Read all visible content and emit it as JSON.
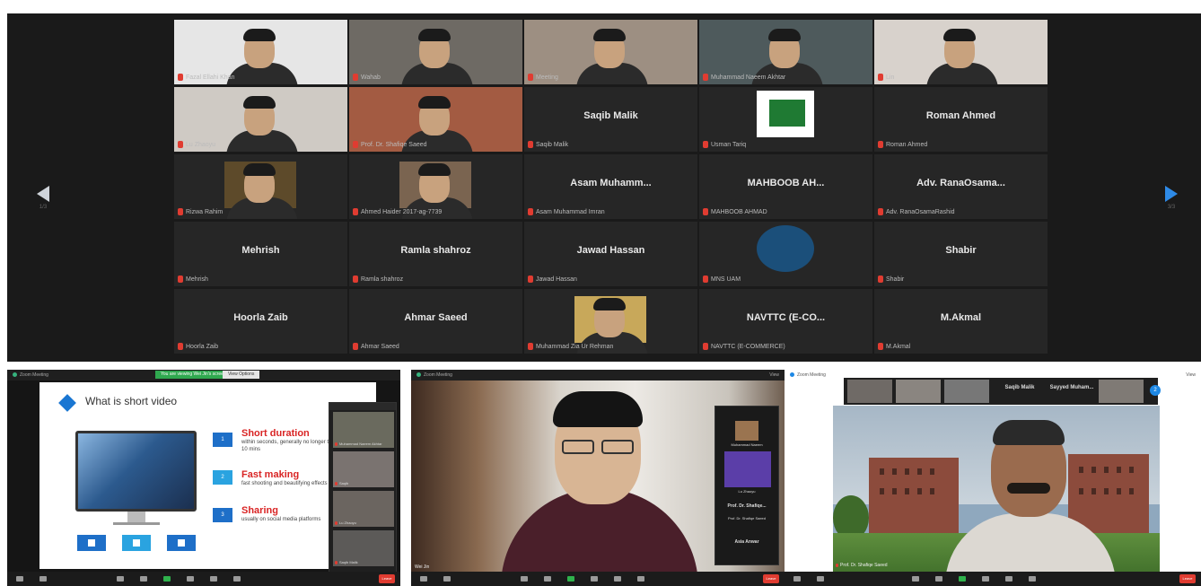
{
  "gallery": {
    "prev_page_label": "1/3",
    "next_page_label": "3/3",
    "tiles": [
      {
        "name": "Fazal Ellahi Khan",
        "center": "",
        "video": true
      },
      {
        "name": "Wahab",
        "center": "",
        "video": true
      },
      {
        "name": "Meeting",
        "center": "",
        "video": true
      },
      {
        "name": "Muhammad Naeem Akhtar",
        "center": "",
        "video": true
      },
      {
        "name": "Lin",
        "center": "",
        "video": true
      },
      {
        "name": "Lu Zhaoyu",
        "center": "",
        "video": true
      },
      {
        "name": "Prof. Dr. Shafiqe Saeed",
        "center": "",
        "video": true
      },
      {
        "name": "Saqib Malik",
        "center": "Saqib Malik",
        "video": false
      },
      {
        "name": "Usman Tariq",
        "center": "",
        "video": false
      },
      {
        "name": "Roman Ahmed",
        "center": "Roman Ahmed",
        "video": false
      },
      {
        "name": "Rizwa Rahim",
        "center": "",
        "video": true
      },
      {
        "name": "Ahmed Haider 2017-ag-7739",
        "center": "",
        "video": true
      },
      {
        "name": "Asam Muhammad Imran",
        "center": "Asam Muhamm...",
        "video": false
      },
      {
        "name": "MAHBOOB AHMAD",
        "center": "MAHBOOB AH...",
        "video": false
      },
      {
        "name": "Adv. RanaOsamaRashid",
        "center": "Adv. RanaOsama...",
        "video": false
      },
      {
        "name": "Mehrish",
        "center": "Mehrish",
        "video": false
      },
      {
        "name": "Ramla shahroz",
        "center": "Ramla shahroz",
        "video": false
      },
      {
        "name": "Jawad Hassan",
        "center": "Jawad Hassan",
        "video": false
      },
      {
        "name": "MNS UAM",
        "center": "",
        "video": false
      },
      {
        "name": "Shabir",
        "center": "Shabir",
        "video": false
      },
      {
        "name": "Hoorla Zaib",
        "center": "Hoorla Zaib",
        "video": false
      },
      {
        "name": "Ahmar Saeed",
        "center": "Ahmar Saeed",
        "video": false
      },
      {
        "name": "Muhammad Zia Ur Rehman",
        "center": "",
        "video": true
      },
      {
        "name": "NAVTTC (E-COMMERCE)",
        "center": "NAVTTC (E-CO...",
        "video": false
      },
      {
        "name": "M.Akmal",
        "center": "M.Akmal",
        "video": false
      }
    ]
  },
  "panel1": {
    "window_title": "Zoom Meeting",
    "share_banner": "You are viewing Wei Jin's screen",
    "stop_label": "View Options",
    "slide": {
      "title": "What is short video",
      "items": [
        {
          "num": "1",
          "heading": "Short duration",
          "desc": "within seconds, generally no longer than 10 mins"
        },
        {
          "num": "2",
          "heading": "Fast making",
          "desc": "fast shooting and beautifying effects"
        },
        {
          "num": "3",
          "heading": "Sharing",
          "desc": "usually on social media platforms"
        }
      ]
    },
    "strip": [
      {
        "name": "Muhammad Naeem Akhtar"
      },
      {
        "name": "Saqib"
      },
      {
        "name": "Lu Zhaoyu"
      },
      {
        "name": "Saqib Malik"
      }
    ],
    "end_label": "Leave"
  },
  "panel2": {
    "window_title": "Zoom Meeting",
    "view_label": "View",
    "bottom_caption": "Wei Jin",
    "strip": {
      "tile1": "Muhammad Naeem",
      "tile2": "Lu Zhaoyu",
      "name1": "Prof. Dr. Shafiqe...",
      "cap1": "Prof. Dr. Shafiqe Saeed",
      "name2": "Asia Anwar"
    },
    "end_label": "Leave"
  },
  "panel3": {
    "window_title": "Zoom Meeting",
    "view_label": "View",
    "names": [
      "Saqib Malik",
      "Sayyed Muham..."
    ],
    "badge": "2",
    "caption": "Prof. Dr. Shafiqe Saeed",
    "end_label": "Leave"
  }
}
